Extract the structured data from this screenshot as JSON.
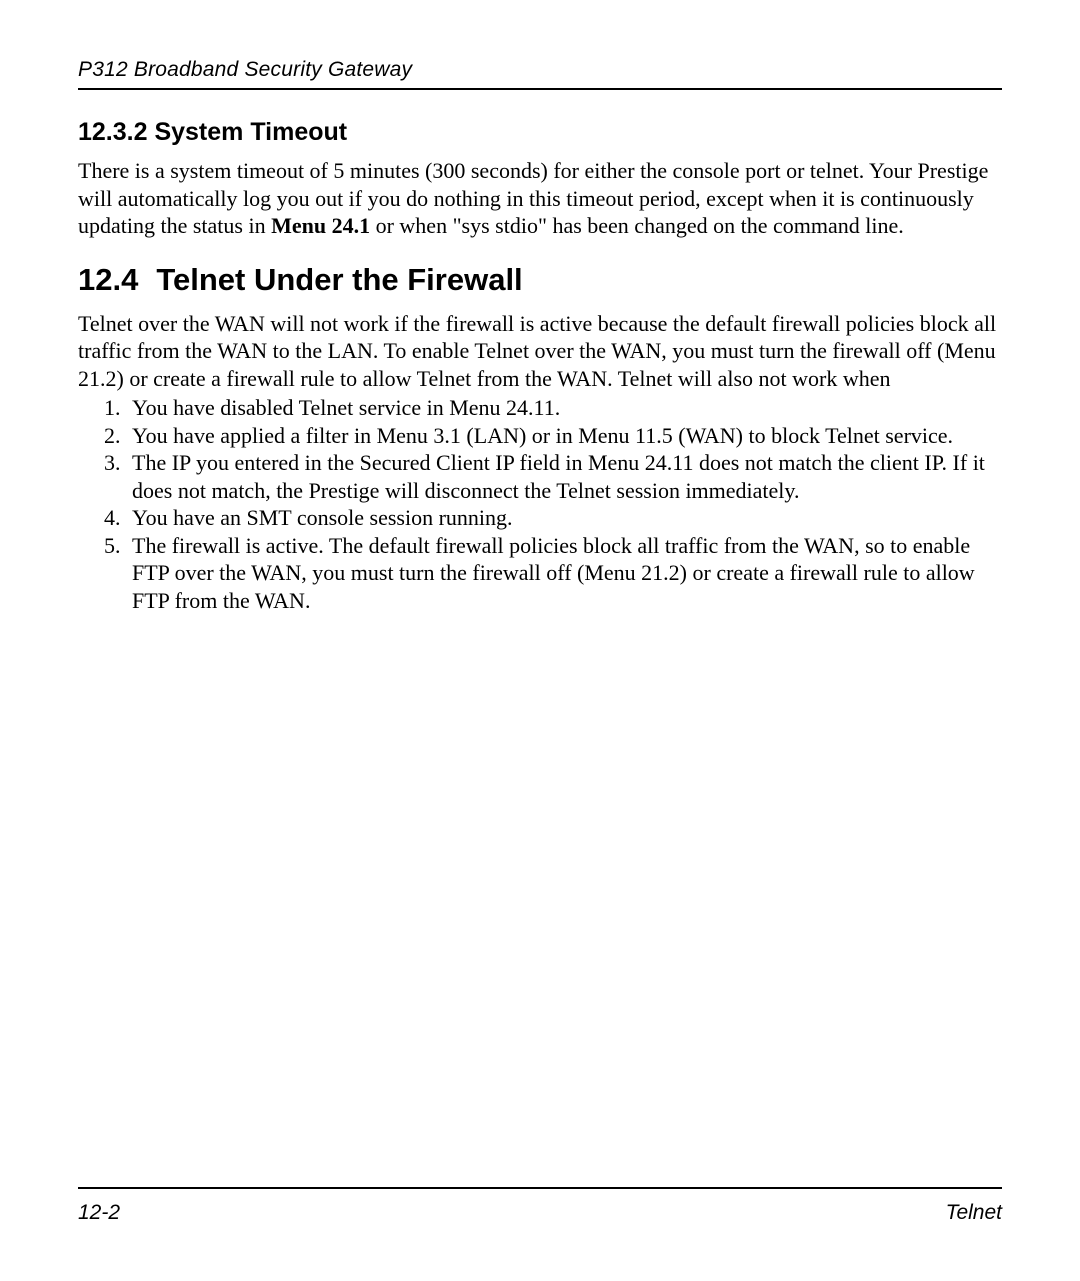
{
  "header": {
    "running_title": "P312  Broadband Security Gateway"
  },
  "section_12_3_2": {
    "heading": "12.3.2 System Timeout",
    "para_before_bold": "There is a system timeout of 5 minutes (300 seconds) for either the console port or telnet. Your Prestige will automatically log you out if you do nothing in this timeout period, except when it is continuously updating the status in ",
    "bold": "Menu 24.1",
    "para_after_bold": " or when \"sys stdio\" has been changed on the command line."
  },
  "section_12_4": {
    "heading_num": "12.4",
    "heading_text": "Telnet Under the Firewall",
    "intro": "Telnet over the WAN will not work if the firewall is active because the default firewall policies block all traffic from the WAN to the LAN. To enable Telnet over the WAN, you must turn the firewall off (Menu 21.2) or create a firewall rule to allow Telnet from the WAN. Telnet will also not work when",
    "items": [
      "You have disabled Telnet service in Menu 24.11.",
      "You have applied a filter in Menu 3.1 (LAN) or in Menu 11.5 (WAN) to block Telnet service.",
      "The IP you entered in the Secured Client IP field in Menu 24.11 does not match the client IP. If it does not match, the Prestige will disconnect the Telnet session immediately.",
      "You have an SMT console session running.",
      "The firewall is active. The default firewall policies block all traffic from the WAN, so to enable FTP over the WAN, you must turn the firewall off (Menu 21.2) or create a firewall rule to allow FTP from the WAN."
    ]
  },
  "footer": {
    "page_number": "12-2",
    "section": "Telnet"
  }
}
